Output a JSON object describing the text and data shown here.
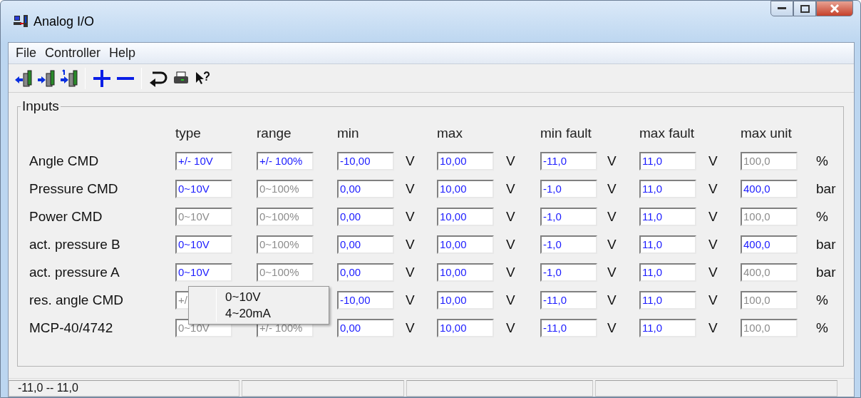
{
  "window": {
    "title": "Analog I/O"
  },
  "menu": [
    "File",
    "Controller",
    "Help"
  ],
  "group": {
    "title": "Inputs",
    "columns": [
      "type",
      "range",
      "min",
      "max",
      "min fault",
      "max fault",
      "max unit"
    ],
    "rows": [
      {
        "label": "Angle CMD",
        "cells": [
          {
            "value": "+/- 10V",
            "enabled": true
          },
          {
            "value": "+/- 100%",
            "enabled": true
          },
          {
            "value": "-10,00",
            "enabled": true,
            "unit": "V"
          },
          {
            "value": "10,00",
            "enabled": true,
            "unit": "V"
          },
          {
            "value": "-11,0",
            "enabled": true,
            "unit": "V"
          },
          {
            "value": "11,0",
            "enabled": true,
            "unit": "V"
          },
          {
            "value": "100,0",
            "enabled": false,
            "unit": "%"
          }
        ]
      },
      {
        "label": "Pressure CMD",
        "cells": [
          {
            "value": "0~10V",
            "enabled": true
          },
          {
            "value": "0~100%",
            "enabled": false
          },
          {
            "value": "0,00",
            "enabled": true,
            "unit": "V"
          },
          {
            "value": "10,00",
            "enabled": true,
            "unit": "V"
          },
          {
            "value": "-1,0",
            "enabled": true,
            "unit": "V"
          },
          {
            "value": "11,0",
            "enabled": true,
            "unit": "V"
          },
          {
            "value": "400,0",
            "enabled": true,
            "unit": "bar"
          }
        ]
      },
      {
        "label": "Power CMD",
        "cells": [
          {
            "value": "0~10V",
            "enabled": false
          },
          {
            "value": "0~100%",
            "enabled": false
          },
          {
            "value": "0,00",
            "enabled": true,
            "unit": "V"
          },
          {
            "value": "10,00",
            "enabled": true,
            "unit": "V"
          },
          {
            "value": "-1,0",
            "enabled": true,
            "unit": "V"
          },
          {
            "value": "11,0",
            "enabled": true,
            "unit": "V"
          },
          {
            "value": "100,0",
            "enabled": false,
            "unit": "%"
          }
        ]
      },
      {
        "label": "act. pressure B",
        "cells": [
          {
            "value": "0~10V",
            "enabled": true
          },
          {
            "value": "0~100%",
            "enabled": false
          },
          {
            "value": "0,00",
            "enabled": true,
            "unit": "V"
          },
          {
            "value": "10,00",
            "enabled": true,
            "unit": "V"
          },
          {
            "value": "-1,0",
            "enabled": true,
            "unit": "V"
          },
          {
            "value": "11,0",
            "enabled": true,
            "unit": "V"
          },
          {
            "value": "400,0",
            "enabled": true,
            "unit": "bar"
          }
        ]
      },
      {
        "label": "act. pressure A",
        "cells": [
          {
            "value": "0~10V",
            "enabled": true
          },
          {
            "value": "0~100%",
            "enabled": false
          },
          {
            "value": "0,00",
            "enabled": true,
            "unit": "V"
          },
          {
            "value": "10,00",
            "enabled": true,
            "unit": "V"
          },
          {
            "value": "-1,0",
            "enabled": true,
            "unit": "V"
          },
          {
            "value": "11,0",
            "enabled": true,
            "unit": "V"
          },
          {
            "value": "400,0",
            "enabled": false,
            "unit": "bar"
          }
        ]
      },
      {
        "label": "res. angle CMD",
        "cells": [
          {
            "value": "+/",
            "enabled": false
          },
          null,
          {
            "value": "-10,00",
            "enabled": true,
            "unit": "V"
          },
          {
            "value": "10,00",
            "enabled": true,
            "unit": "V"
          },
          {
            "value": "-11,0",
            "enabled": true,
            "unit": "V"
          },
          {
            "value": "11,0",
            "enabled": true,
            "unit": "V"
          },
          {
            "value": "100,0",
            "enabled": false,
            "unit": "%"
          }
        ]
      },
      {
        "label": "MCP-40/4742",
        "cells": [
          {
            "value": "0~10V",
            "enabled": false
          },
          {
            "value": "+/- 100%",
            "enabled": false
          },
          {
            "value": "0,00",
            "enabled": true,
            "unit": "V"
          },
          {
            "value": "10,00",
            "enabled": true,
            "unit": "V"
          },
          {
            "value": "-11,0",
            "enabled": true,
            "unit": "V"
          },
          {
            "value": "11,0",
            "enabled": true,
            "unit": "V"
          },
          {
            "value": "100,0",
            "enabled": false,
            "unit": "%"
          }
        ]
      }
    ]
  },
  "context_menu": [
    "0~10V",
    "4~20mA"
  ],
  "status_bar": [
    "-11,0 -- 11,0"
  ]
}
